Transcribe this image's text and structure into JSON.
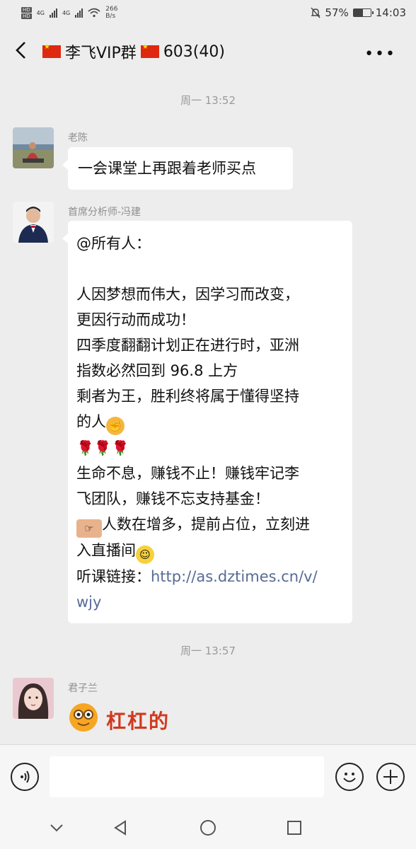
{
  "status_bar": {
    "hd_top": "HD",
    "hd_bottom": "HD",
    "net1": "4G",
    "net2": "4G",
    "speed_value": "266",
    "speed_unit": "B/s",
    "battery_percent": "57%",
    "battery_level": 0.57,
    "clock": "14:03"
  },
  "header": {
    "title_name": "李飞VIP群",
    "title_count": "603(40)"
  },
  "messages": {
    "time_1": "周一 13:52",
    "msg1": {
      "sender": "老陈",
      "text": "一会课堂上再跟着老师买点"
    },
    "msg2": {
      "sender": "首席分析师-冯建",
      "line1": "@所有人：",
      "line2": "人因梦想而伟大，因学习而改变，\n更因行动而成功！\n四季度翻翻计划正在进行时，亚洲\n指数必然回到 96.8 上方\n剩者为王，胜利终将属于懂得坚持\n的人",
      "line3": "生命不息，赚钱不止！赚钱牢记李\n飞团队，赚钱不忘支持基金！",
      "line4": "人数在增多，提前占位，立刻进\n入直播间",
      "link_label": "听课链接：",
      "link_url": "http://as.dztimes.cn/v/\nwjy"
    },
    "time_2": "周一 13:57",
    "msg3": {
      "sender": "君子兰",
      "sticker_text": "杠杠的"
    }
  },
  "icons": {
    "back": "back-arrow-icon",
    "more": "more-dots-icon",
    "voice": "voice-icon",
    "emoji": "emoji-icon",
    "plus": "plus-icon"
  },
  "colors": {
    "background": "#ededed",
    "bubble": "#ffffff",
    "link": "#576b95",
    "flag_red": "#de2910"
  }
}
